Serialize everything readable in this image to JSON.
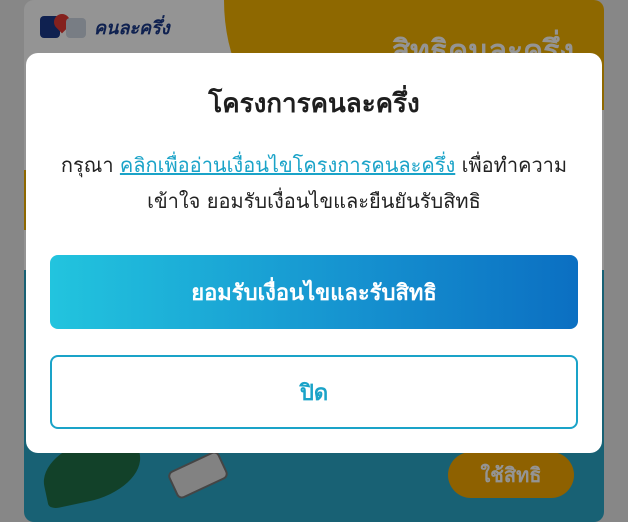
{
  "background": {
    "logo_text": "คนละครึ่ง",
    "header_title": "สิทธิคนละครึ่ง",
    "use_button_label": "ใช้สิทธิ",
    "colors": {
      "yellow": "#f5b400",
      "banner_blue": "#2aa7c9"
    }
  },
  "modal": {
    "title": "โครงการคนละครึ่ง",
    "body_prefix": "กรุณา ",
    "body_link": "คลิกเพื่ออ่านเงื่อนไขโครงการคนละครึ่ง",
    "body_suffix": " เพื่อทำความเข้าใจ ยอมรับเงื่อนไขและยืนยันรับสิทธิ",
    "accept_button": "ยอมรับเงื่อนไขและรับสิทธิ",
    "close_button": "ปิด",
    "colors": {
      "accent": "#1aa3c8",
      "gradient_start": "#22c4de",
      "gradient_end": "#0b6fc2"
    }
  }
}
